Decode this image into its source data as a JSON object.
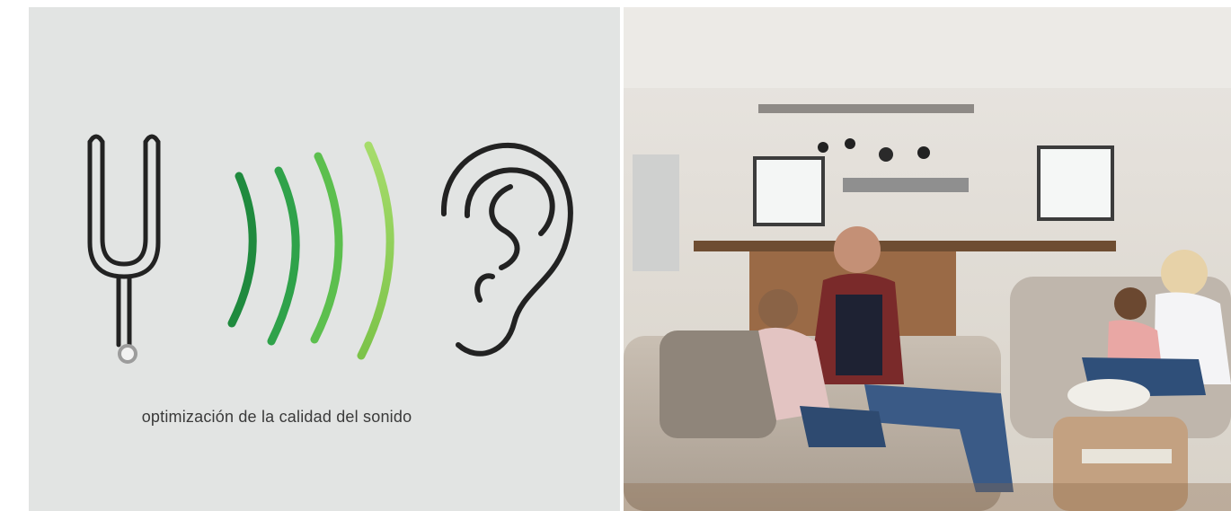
{
  "left_panel": {
    "caption": "optimización de la calidad del sonido",
    "icons": {
      "fork": "tuning-fork-icon",
      "waves": "sound-waves-icon",
      "ear": "ear-icon"
    },
    "colors": {
      "background": "#e2e4e3",
      "stroke": "#222222",
      "wave_dark": "#1f8a3e",
      "wave_light": "#8fd15a",
      "caption": "#3a3a3a"
    }
  },
  "right_panel": {
    "photo": "family-living-room-photo"
  }
}
